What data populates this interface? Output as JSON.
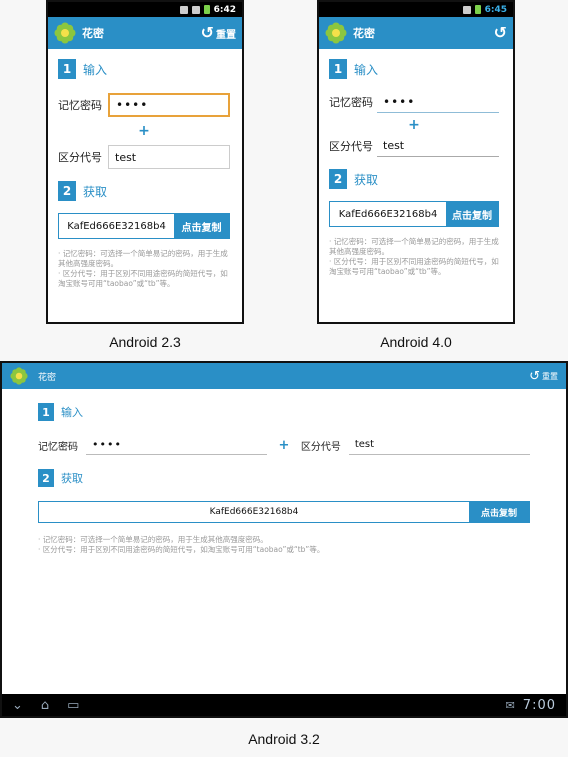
{
  "app": {
    "title": "花密",
    "reset_label": "重置",
    "section1_num": "1",
    "section1_label": "输入",
    "section2_num": "2",
    "section2_label": "获取",
    "memory_label": "记忆密码",
    "memory_value": "••••",
    "plus_sign": "+",
    "code_label": "区分代号",
    "code_value": "test",
    "result_value": "KafEd666E32168b4",
    "copy_label": "点击复制",
    "note1": "· 记忆密码：可选择一个简单易记的密码，用于生成其他高强度密码。",
    "note2": "· 区分代号：用于区别不同用途密码的简短代号，如淘宝账号可用“taobao”或“tb”等。"
  },
  "devices": {
    "android23": {
      "time": "6:42",
      "caption": "Android 2.3"
    },
    "android40": {
      "time": "6:45",
      "caption": "Android 4.0"
    },
    "android32": {
      "time": "7:00",
      "caption": "Android 3.2"
    }
  },
  "colors": {
    "accent": "#2a8fc6",
    "focus": "#e8a23a"
  },
  "icons": [
    "flower-logo-icon",
    "back-arrow-icon",
    "nav-back-icon",
    "nav-home-icon",
    "nav-recent-icon"
  ]
}
